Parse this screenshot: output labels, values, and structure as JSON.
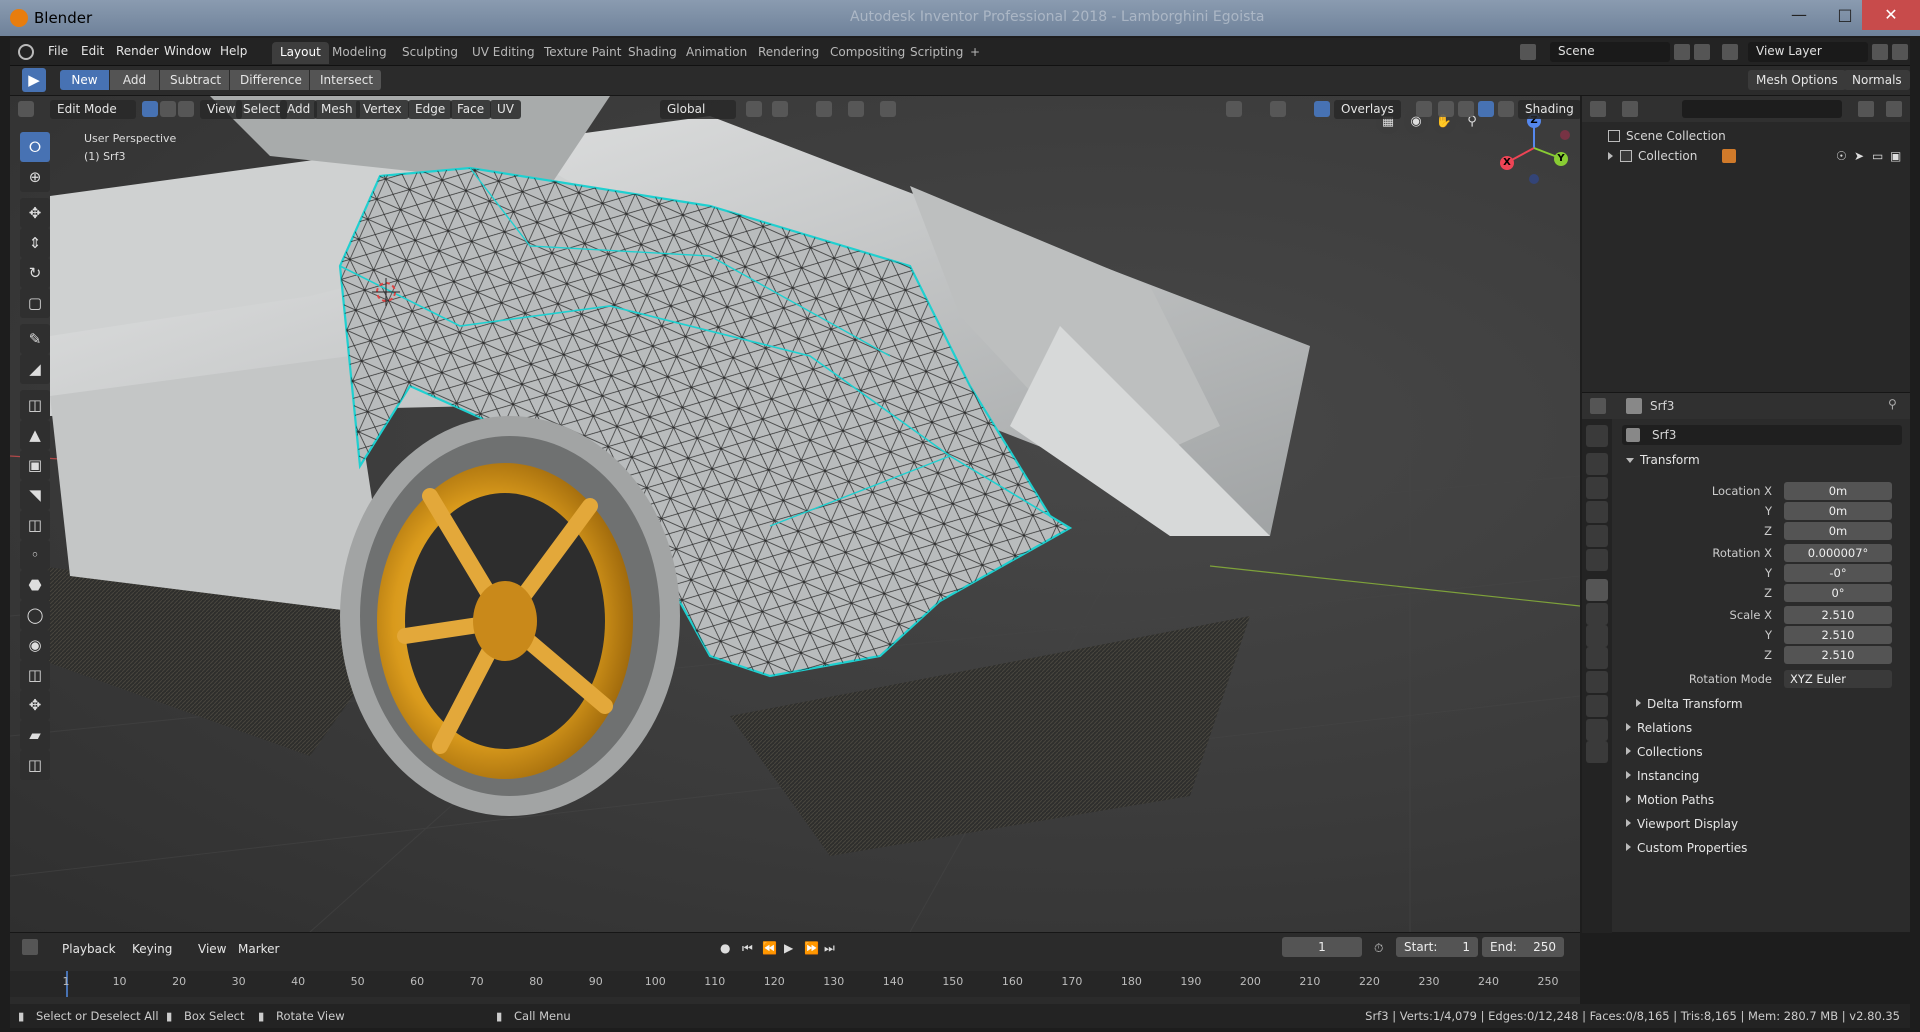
{
  "window": {
    "title": "Blender",
    "background_title": "Autodesk Inventor Professional 2018 - Lamborghini Egoista"
  },
  "menu": {
    "items": [
      "File",
      "Edit",
      "Render",
      "Window",
      "Help"
    ]
  },
  "workspaces": {
    "tabs": [
      "Layout",
      "Modeling",
      "Sculpting",
      "UV Editing",
      "Texture Paint",
      "Shading",
      "Animation",
      "Rendering",
      "Compositing",
      "Scripting"
    ],
    "active": "Layout",
    "add": "+"
  },
  "scene": {
    "name": "Scene",
    "view_layer": "View Layer"
  },
  "tool_header": {
    "bool_ops": [
      "New",
      "Add",
      "Subtract",
      "Difference",
      "Intersect"
    ],
    "active_op": "New",
    "mesh_options": "Mesh Options",
    "normals": "Normals"
  },
  "viewport": {
    "mode": "Edit Mode",
    "menus": [
      "View",
      "Select",
      "Add",
      "Mesh",
      "Vertex",
      "Edge",
      "Face",
      "UV"
    ],
    "orientation": "Global",
    "overlays": "Overlays",
    "shading": "Shading",
    "info_line1": "User Perspective",
    "info_line2": "(1) Srf3",
    "gizmo": {
      "x": "X",
      "y": "Y",
      "z": "Z"
    }
  },
  "outliner": {
    "rows": [
      {
        "label": "Scene Collection"
      },
      {
        "label": "Collection"
      }
    ]
  },
  "properties": {
    "object_name": "Srf3",
    "data_name": "Srf3",
    "transform_title": "Transform",
    "location": {
      "label": "Location X",
      "x": "0m",
      "y": "0m",
      "z": "0m"
    },
    "rotation": {
      "label": "Rotation X",
      "x": "0.000007°",
      "y": "-0°",
      "z": "0°"
    },
    "scale": {
      "label": "Scale X",
      "x": "2.510",
      "y": "2.510",
      "z": "2.510"
    },
    "axis_y": "Y",
    "axis_z": "Z",
    "rotation_mode_label": "Rotation Mode",
    "rotation_mode": "XYZ Euler",
    "delta": "Delta Transform",
    "panels": [
      "Relations",
      "Collections",
      "Instancing",
      "Motion Paths",
      "Viewport Display",
      "Custom Properties"
    ]
  },
  "timeline": {
    "menus": [
      "Playback",
      "Keying",
      "View",
      "Marker"
    ],
    "current_frame": "1",
    "start_label": "Start:",
    "start": "1",
    "end_label": "End:",
    "end": "250",
    "ticks": [
      "1",
      "10",
      "20",
      "30",
      "40",
      "50",
      "60",
      "70",
      "80",
      "90",
      "100",
      "110",
      "120",
      "130",
      "140",
      "150",
      "160",
      "170",
      "180",
      "190",
      "200",
      "210",
      "220",
      "230",
      "240",
      "250"
    ]
  },
  "status": {
    "hints": [
      "Select or Deselect All",
      "Box Select",
      "Rotate View",
      "Call Menu"
    ],
    "stats": "Srf3 | Verts:1/4,079 | Edges:0/12,248 | Faces:0/8,165 | Tris:8,165 | Mem: 280.7 MB | v2.80.35"
  },
  "colors": {
    "accent": "#4772b3",
    "wire_selected": "#1fd0d0",
    "wheel_gold": "#d99a1c"
  }
}
